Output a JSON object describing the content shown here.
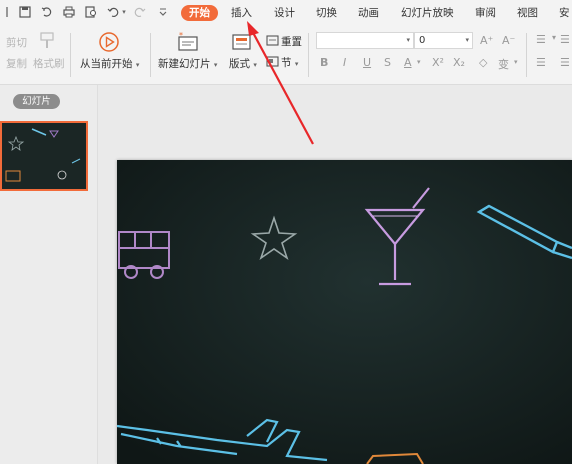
{
  "menubar": {
    "tabs": [
      "开始",
      "插入",
      "设计",
      "切换",
      "动画",
      "幻灯片放映",
      "审阅",
      "视图",
      "安"
    ],
    "active_tab": "开始",
    "quick_access": [
      "menu-icon",
      "save-icon",
      "redo-history-icon",
      "print-icon",
      "print-preview-icon",
      "undo-icon",
      "redo-icon",
      "customize-icon"
    ]
  },
  "ribbon": {
    "cut": "剪切",
    "copy": "复制",
    "format_painter": "格式刷",
    "play_from_current": "从当前开始",
    "new_slide": "新建幻灯片",
    "layout": "版式",
    "reset": "重置",
    "section": "节",
    "font_size": "0",
    "font_name": ""
  },
  "sidebar": {
    "pill": "幻灯片"
  },
  "colors": {
    "accent": "#f26b3a",
    "arrow": "#e8272a",
    "chalkboard": "#151f1e"
  }
}
